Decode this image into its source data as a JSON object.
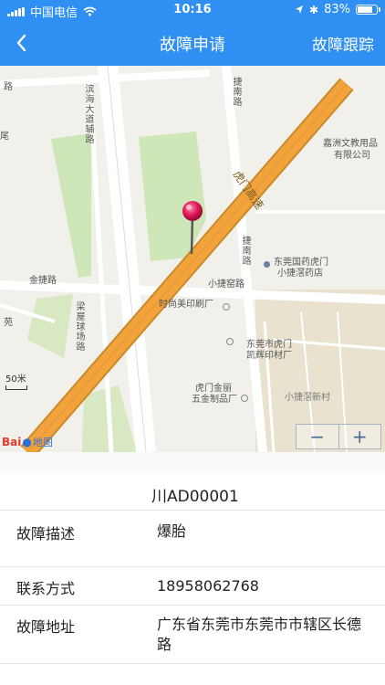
{
  "status_bar": {
    "carrier": "中国电信",
    "time": "10:16",
    "battery_text": "83%",
    "battery_level": 0.83
  },
  "navbar": {
    "back_icon": "chevron-left-icon",
    "title": "故障申请",
    "right_action": "故障跟踪"
  },
  "map": {
    "labels": {
      "binhai": "滨海大道辅路",
      "jienan": "捷南路",
      "jiezhou1": "捷南路",
      "humen_expressway": "虎门高速",
      "jiazhou": "嘉洲文教用品",
      "jiazhou2": "有限公司",
      "pharmacy1": "东莞国药虎门",
      "pharmacy2": "小捷滘药店",
      "jinjie": "金捷路",
      "xiaojie_road": "小捷窑路",
      "shishangmei": "时尚美印刷厂",
      "liangwu": "梁屋球场路",
      "kaihui1": "东莞市虎门",
      "kaihui2": "凯辉印材厂",
      "jinli1": "虎门金丽",
      "jinli2": "五金制品厂",
      "xiaojie_village": "小捷滘新村",
      "edge_lu": "路",
      "edge_yuan": "苑",
      "edge_wei": "尾"
    },
    "scale_text": "50米",
    "logo_text_1": "Bai",
    "logo_text_2": "地图",
    "zoom_out": "−",
    "zoom_in": "+"
  },
  "form": {
    "plate": "川AD00001",
    "fault_label": "故障描述",
    "fault_value": "爆胎",
    "contact_label": "联系方式",
    "contact_value": "18958062768",
    "address_label": "故障地址",
    "address_value": "广东省东莞市东莞市市辖区长德路"
  }
}
